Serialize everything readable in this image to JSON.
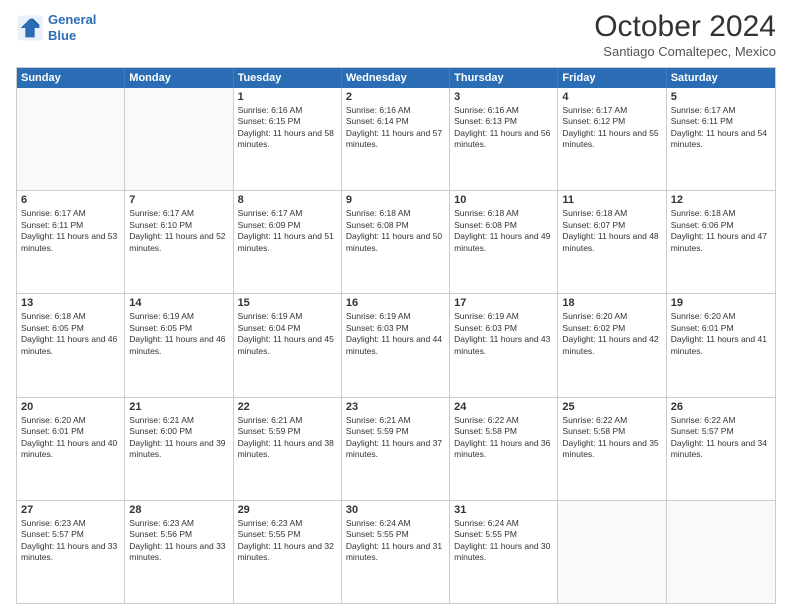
{
  "header": {
    "logo_line1": "General",
    "logo_line2": "Blue",
    "month": "October 2024",
    "location": "Santiago Comaltepec, Mexico"
  },
  "weekdays": [
    "Sunday",
    "Monday",
    "Tuesday",
    "Wednesday",
    "Thursday",
    "Friday",
    "Saturday"
  ],
  "rows": [
    [
      {
        "day": "",
        "sunrise": "",
        "sunset": "",
        "daylight": ""
      },
      {
        "day": "",
        "sunrise": "",
        "sunset": "",
        "daylight": ""
      },
      {
        "day": "1",
        "sunrise": "Sunrise: 6:16 AM",
        "sunset": "Sunset: 6:15 PM",
        "daylight": "Daylight: 11 hours and 58 minutes."
      },
      {
        "day": "2",
        "sunrise": "Sunrise: 6:16 AM",
        "sunset": "Sunset: 6:14 PM",
        "daylight": "Daylight: 11 hours and 57 minutes."
      },
      {
        "day": "3",
        "sunrise": "Sunrise: 6:16 AM",
        "sunset": "Sunset: 6:13 PM",
        "daylight": "Daylight: 11 hours and 56 minutes."
      },
      {
        "day": "4",
        "sunrise": "Sunrise: 6:17 AM",
        "sunset": "Sunset: 6:12 PM",
        "daylight": "Daylight: 11 hours and 55 minutes."
      },
      {
        "day": "5",
        "sunrise": "Sunrise: 6:17 AM",
        "sunset": "Sunset: 6:11 PM",
        "daylight": "Daylight: 11 hours and 54 minutes."
      }
    ],
    [
      {
        "day": "6",
        "sunrise": "Sunrise: 6:17 AM",
        "sunset": "Sunset: 6:11 PM",
        "daylight": "Daylight: 11 hours and 53 minutes."
      },
      {
        "day": "7",
        "sunrise": "Sunrise: 6:17 AM",
        "sunset": "Sunset: 6:10 PM",
        "daylight": "Daylight: 11 hours and 52 minutes."
      },
      {
        "day": "8",
        "sunrise": "Sunrise: 6:17 AM",
        "sunset": "Sunset: 6:09 PM",
        "daylight": "Daylight: 11 hours and 51 minutes."
      },
      {
        "day": "9",
        "sunrise": "Sunrise: 6:18 AM",
        "sunset": "Sunset: 6:08 PM",
        "daylight": "Daylight: 11 hours and 50 minutes."
      },
      {
        "day": "10",
        "sunrise": "Sunrise: 6:18 AM",
        "sunset": "Sunset: 6:08 PM",
        "daylight": "Daylight: 11 hours and 49 minutes."
      },
      {
        "day": "11",
        "sunrise": "Sunrise: 6:18 AM",
        "sunset": "Sunset: 6:07 PM",
        "daylight": "Daylight: 11 hours and 48 minutes."
      },
      {
        "day": "12",
        "sunrise": "Sunrise: 6:18 AM",
        "sunset": "Sunset: 6:06 PM",
        "daylight": "Daylight: 11 hours and 47 minutes."
      }
    ],
    [
      {
        "day": "13",
        "sunrise": "Sunrise: 6:18 AM",
        "sunset": "Sunset: 6:05 PM",
        "daylight": "Daylight: 11 hours and 46 minutes."
      },
      {
        "day": "14",
        "sunrise": "Sunrise: 6:19 AM",
        "sunset": "Sunset: 6:05 PM",
        "daylight": "Daylight: 11 hours and 46 minutes."
      },
      {
        "day": "15",
        "sunrise": "Sunrise: 6:19 AM",
        "sunset": "Sunset: 6:04 PM",
        "daylight": "Daylight: 11 hours and 45 minutes."
      },
      {
        "day": "16",
        "sunrise": "Sunrise: 6:19 AM",
        "sunset": "Sunset: 6:03 PM",
        "daylight": "Daylight: 11 hours and 44 minutes."
      },
      {
        "day": "17",
        "sunrise": "Sunrise: 6:19 AM",
        "sunset": "Sunset: 6:03 PM",
        "daylight": "Daylight: 11 hours and 43 minutes."
      },
      {
        "day": "18",
        "sunrise": "Sunrise: 6:20 AM",
        "sunset": "Sunset: 6:02 PM",
        "daylight": "Daylight: 11 hours and 42 minutes."
      },
      {
        "day": "19",
        "sunrise": "Sunrise: 6:20 AM",
        "sunset": "Sunset: 6:01 PM",
        "daylight": "Daylight: 11 hours and 41 minutes."
      }
    ],
    [
      {
        "day": "20",
        "sunrise": "Sunrise: 6:20 AM",
        "sunset": "Sunset: 6:01 PM",
        "daylight": "Daylight: 11 hours and 40 minutes."
      },
      {
        "day": "21",
        "sunrise": "Sunrise: 6:21 AM",
        "sunset": "Sunset: 6:00 PM",
        "daylight": "Daylight: 11 hours and 39 minutes."
      },
      {
        "day": "22",
        "sunrise": "Sunrise: 6:21 AM",
        "sunset": "Sunset: 5:59 PM",
        "daylight": "Daylight: 11 hours and 38 minutes."
      },
      {
        "day": "23",
        "sunrise": "Sunrise: 6:21 AM",
        "sunset": "Sunset: 5:59 PM",
        "daylight": "Daylight: 11 hours and 37 minutes."
      },
      {
        "day": "24",
        "sunrise": "Sunrise: 6:22 AM",
        "sunset": "Sunset: 5:58 PM",
        "daylight": "Daylight: 11 hours and 36 minutes."
      },
      {
        "day": "25",
        "sunrise": "Sunrise: 6:22 AM",
        "sunset": "Sunset: 5:58 PM",
        "daylight": "Daylight: 11 hours and 35 minutes."
      },
      {
        "day": "26",
        "sunrise": "Sunrise: 6:22 AM",
        "sunset": "Sunset: 5:57 PM",
        "daylight": "Daylight: 11 hours and 34 minutes."
      }
    ],
    [
      {
        "day": "27",
        "sunrise": "Sunrise: 6:23 AM",
        "sunset": "Sunset: 5:57 PM",
        "daylight": "Daylight: 11 hours and 33 minutes."
      },
      {
        "day": "28",
        "sunrise": "Sunrise: 6:23 AM",
        "sunset": "Sunset: 5:56 PM",
        "daylight": "Daylight: 11 hours and 33 minutes."
      },
      {
        "day": "29",
        "sunrise": "Sunrise: 6:23 AM",
        "sunset": "Sunset: 5:55 PM",
        "daylight": "Daylight: 11 hours and 32 minutes."
      },
      {
        "day": "30",
        "sunrise": "Sunrise: 6:24 AM",
        "sunset": "Sunset: 5:55 PM",
        "daylight": "Daylight: 11 hours and 31 minutes."
      },
      {
        "day": "31",
        "sunrise": "Sunrise: 6:24 AM",
        "sunset": "Sunset: 5:55 PM",
        "daylight": "Daylight: 11 hours and 30 minutes."
      },
      {
        "day": "",
        "sunrise": "",
        "sunset": "",
        "daylight": ""
      },
      {
        "day": "",
        "sunrise": "",
        "sunset": "",
        "daylight": ""
      }
    ]
  ]
}
